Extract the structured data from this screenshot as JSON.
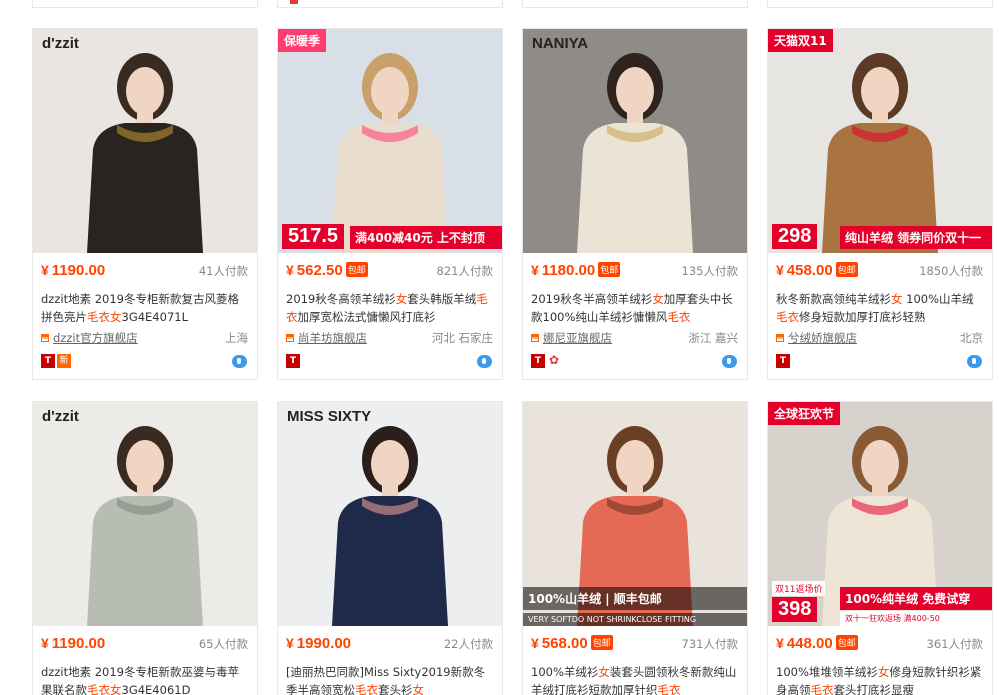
{
  "cards": [
    {
      "brand_mark": "d'zzit",
      "badge": "",
      "price_symbol": "¥",
      "price": "1190.00",
      "baoyou": "",
      "sold": "41人付款",
      "title": [
        "dzzit地素 2019冬专柜新款复古风菱格拼色亮片",
        "毛衣女",
        "3G4E4071L"
      ],
      "shop": "dzzit官方旗舰店",
      "location": "上海",
      "icons": [
        "tmall-icon",
        "new-icon"
      ],
      "icon_text": {
        "tmall": "T",
        "new": "新"
      },
      "colors": {
        "bg": "#e9e6e2",
        "sweater": "#2a2420",
        "accent": "#c79a2f",
        "hair": "#3a2b22"
      }
    },
    {
      "brand_mark": "",
      "badge": "保暖季",
      "badge_color": "#ff3b6f",
      "promo_price": "517.5",
      "promo_text": "满400减40元 上不封顶",
      "price_symbol": "¥",
      "price": "562.50",
      "baoyou": "包邮",
      "sold": "821人付款",
      "title": [
        "2019秋冬高领羊绒衫",
        "女",
        "套头韩版羊绒",
        "毛衣",
        "加厚宽松法式慵懒风打底衫"
      ],
      "shop": "尚羊坊旗舰店",
      "location": "河北 石家庄",
      "icons": [
        "tmall-icon"
      ],
      "icon_text": {
        "tmall": "T",
        "new": ""
      },
      "colors": {
        "bg": "#d9dfe6",
        "sweater": "#e8dccc",
        "accent": "#ff3b6f",
        "hair": "#c9a06a"
      }
    },
    {
      "brand_mark": "NANIYA",
      "badge": "",
      "price_symbol": "¥",
      "price": "1180.00",
      "baoyou": "包邮",
      "sold": "135人付款",
      "title": [
        "2019秋冬半高领羊绒衫",
        "女",
        "加厚套头中长款100%纯山羊绒衫慵懒风",
        "毛衣"
      ],
      "shop": "娜尼亚旗舰店",
      "location": "浙江 嘉兴",
      "icons": [
        "tmall-icon",
        "rose-icon"
      ],
      "icon_text": {
        "tmall": "T",
        "new": ""
      },
      "colors": {
        "bg": "#8f8c88",
        "sweater": "#ebe4d6",
        "accent": "#c9a14a",
        "hair": "#2e231d"
      }
    },
    {
      "brand_mark": "",
      "badge": "天猫双11",
      "badge_color": "#e4002b",
      "promo_price": "298",
      "promo_text": "纯山羊绒 领券同价双十一",
      "price_symbol": "¥",
      "price": "458.00",
      "baoyou": "包邮",
      "sold": "1850人付款",
      "title": [
        "秋冬新款高领纯羊绒衫",
        "女",
        " 100%山羊绒",
        "毛衣",
        "修身短款加厚打底衫轻熟"
      ],
      "shop": "兮绒娇旗舰店",
      "location": "北京",
      "icons": [
        "tmall-icon"
      ],
      "icon_text": {
        "tmall": "T",
        "new": ""
      },
      "colors": {
        "bg": "#e7e5e2",
        "sweater": "#a9743f",
        "accent": "#e4002b",
        "hair": "#5b3a26"
      }
    },
    {
      "brand_mark": "d'zzit",
      "badge": "",
      "price_symbol": "¥",
      "price": "1190.00",
      "baoyou": "",
      "sold": "65人付款",
      "title": [
        "dzzit地素 2019冬专柜新款巫婆与毒苹果联名款",
        "毛衣女",
        "3G4E4061D"
      ],
      "shop": "",
      "location": "",
      "icons": [],
      "icon_text": {
        "tmall": "",
        "new": ""
      },
      "colors": {
        "bg": "#ecebe8",
        "sweater": "#b8bdb4",
        "accent": "#7d8277",
        "hair": "#3a2b22"
      }
    },
    {
      "brand_mark": "MISS SIXTY",
      "badge": "",
      "price_symbol": "¥",
      "price": "1990.00",
      "baoyou": "",
      "sold": "22人付款",
      "title": [
        "[迪丽热巴同款]Miss Sixty2019新款冬季半高领宽松",
        "毛衣",
        "套头衫",
        "女"
      ],
      "shop": "",
      "location": "",
      "icons": [],
      "icon_text": {
        "tmall": "",
        "new": ""
      },
      "colors": {
        "bg": "#eceef0",
        "sweater": "#1f2a4a",
        "accent": "#f2a6a0",
        "hair": "#2a1f1a"
      }
    },
    {
      "brand_mark": "",
      "badge": "",
      "promo_text": "100%山羊绒 | 顺丰包邮",
      "promo_sub": "VERY SOFTDO NOT SHRINKCLOSE FITTING",
      "price_symbol": "¥",
      "price": "568.00",
      "baoyou": "包邮",
      "sold": "731人付款",
      "title": [
        "100%羊绒衫",
        "女",
        "装套头圆领秋冬新款纯山羊绒打底衫短款加厚针织",
        "毛衣"
      ],
      "shop": "",
      "location": "",
      "icons": [],
      "icon_text": {
        "tmall": "",
        "new": ""
      },
      "colors": {
        "bg": "#e9e3dc",
        "sweater": "#e46a55",
        "accent": "#6b2b1f",
        "hair": "#6a3f26"
      }
    },
    {
      "brand_mark": "",
      "badge": "全球狂欢节",
      "badge_color": "#e4002b",
      "promo_price": "398",
      "promo_text": "100%纯羊绒 免费试穿",
      "promo_sub": "双十一狂欢返场 满400-50",
      "promo_label": "双11返场价",
      "price_symbol": "¥",
      "price": "448.00",
      "baoyou": "包邮",
      "sold": "361人付款",
      "title": [
        "100%堆堆领羊绒衫",
        "女",
        "修身短款针织衫紧身高领",
        "毛衣",
        "套头打底衫显瘦"
      ],
      "shop": "",
      "location": "",
      "icons": [],
      "icon_text": {
        "tmall": "",
        "new": ""
      },
      "colors": {
        "bg": "#d8d2cc",
        "sweater": "#efe5d6",
        "accent": "#e4002b",
        "hair": "#8a5a34"
      }
    }
  ]
}
